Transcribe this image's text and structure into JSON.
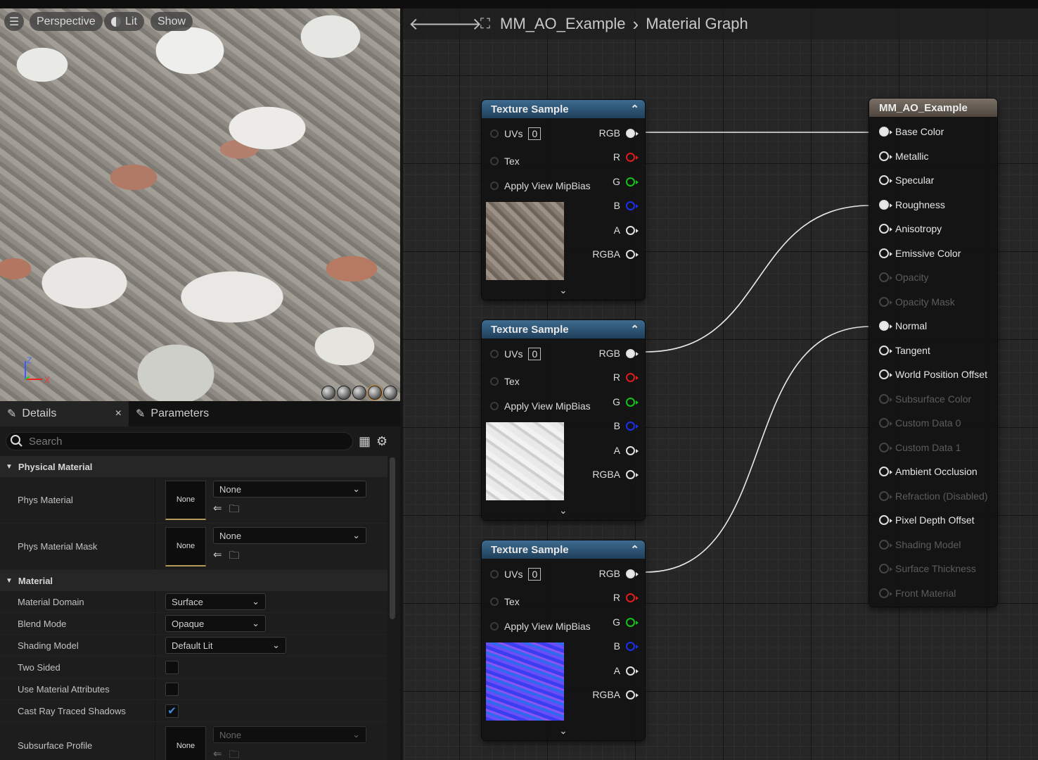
{
  "viewport": {
    "menu_icon": "hamburger-icon",
    "perspective_label": "Perspective",
    "lit_label": "Lit",
    "show_label": "Show",
    "axis_z": "Z",
    "axis_x": "X"
  },
  "details": {
    "tab_details": "Details",
    "tab_close": "×",
    "tab_parameters": "Parameters",
    "search_placeholder": "Search",
    "cat_physical": "Physical Material",
    "phys_material_label": "Phys Material",
    "phys_material_thumb": "None",
    "phys_material_value": "None",
    "phys_mask_label": "Phys Material Mask",
    "phys_mask_thumb": "None",
    "phys_mask_value": "None",
    "cat_material": "Material",
    "material_domain_label": "Material Domain",
    "material_domain_value": "Surface",
    "blend_mode_label": "Blend Mode",
    "blend_mode_value": "Opaque",
    "shading_model_label": "Shading Model",
    "shading_model_value": "Default Lit",
    "two_sided_label": "Two Sided",
    "two_sided": false,
    "use_attrs_label": "Use Material Attributes",
    "use_attrs": false,
    "cast_shadows_label": "Cast Ray Traced Shadows",
    "cast_shadows": true,
    "subsurface_label": "Subsurface Profile",
    "subsurface_thumb": "None",
    "subsurface_value": "None"
  },
  "graph": {
    "breadcrumb_asset": "MM_AO_Example",
    "breadcrumb_sep": "›",
    "breadcrumb_page": "Material Graph"
  },
  "texture_nodes": [
    {
      "title": "Texture Sample",
      "uvs_label": "UVs",
      "uvs_value": "0",
      "tex_label": "Tex",
      "mip_label": "Apply View MipBias",
      "outputs": [
        "RGB",
        "R",
        "G",
        "B",
        "A",
        "RGBA"
      ]
    },
    {
      "title": "Texture Sample",
      "uvs_label": "UVs",
      "uvs_value": "0",
      "tex_label": "Tex",
      "mip_label": "Apply View MipBias",
      "outputs": [
        "RGB",
        "R",
        "G",
        "B",
        "A",
        "RGBA"
      ]
    },
    {
      "title": "Texture Sample",
      "uvs_label": "UVs",
      "uvs_value": "0",
      "tex_label": "Tex",
      "mip_label": "Apply View MipBias",
      "outputs": [
        "RGB",
        "R",
        "G",
        "B",
        "A",
        "RGBA"
      ]
    }
  ],
  "material_node": {
    "title": "MM_AO_Example",
    "pins": [
      {
        "label": "Base Color",
        "enabled": true,
        "connected": true
      },
      {
        "label": "Metallic",
        "enabled": true,
        "connected": false
      },
      {
        "label": "Specular",
        "enabled": true,
        "connected": false
      },
      {
        "label": "Roughness",
        "enabled": true,
        "connected": true
      },
      {
        "label": "Anisotropy",
        "enabled": true,
        "connected": false
      },
      {
        "label": "Emissive Color",
        "enabled": true,
        "connected": false
      },
      {
        "label": "Opacity",
        "enabled": false,
        "connected": false
      },
      {
        "label": "Opacity Mask",
        "enabled": false,
        "connected": false
      },
      {
        "label": "Normal",
        "enabled": true,
        "connected": true
      },
      {
        "label": "Tangent",
        "enabled": true,
        "connected": false
      },
      {
        "label": "World Position Offset",
        "enabled": true,
        "connected": false
      },
      {
        "label": "Subsurface Color",
        "enabled": false,
        "connected": false
      },
      {
        "label": "Custom Data 0",
        "enabled": false,
        "connected": false
      },
      {
        "label": "Custom Data 1",
        "enabled": false,
        "connected": false
      },
      {
        "label": "Ambient Occlusion",
        "enabled": true,
        "connected": false
      },
      {
        "label": "Refraction (Disabled)",
        "enabled": false,
        "connected": false
      },
      {
        "label": "Pixel Depth Offset",
        "enabled": true,
        "connected": false
      },
      {
        "label": "Shading Model",
        "enabled": false,
        "connected": false
      },
      {
        "label": "Surface Thickness",
        "enabled": false,
        "connected": false
      },
      {
        "label": "Front Material",
        "enabled": false,
        "connected": false
      }
    ]
  },
  "colors": {
    "accent_blue": "#3d8de0",
    "pin_red": "#e21b1b",
    "pin_green": "#12c31a",
    "pin_blue": "#1a2ff0",
    "node_header": "#2c5577",
    "material_header": "#6b6158"
  }
}
